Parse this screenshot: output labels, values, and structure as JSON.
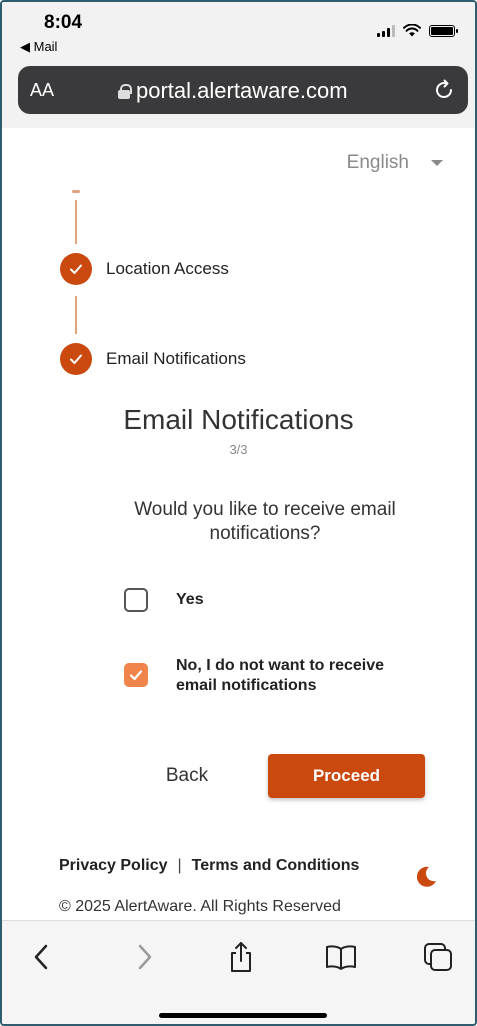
{
  "status_bar": {
    "time": "8:04",
    "back_app": "◀ Mail"
  },
  "browser": {
    "text_size_label": "AA",
    "url": "portal.alertaware.com"
  },
  "language": {
    "selected": "English"
  },
  "stepper": {
    "steps": [
      {
        "label": "Location Access",
        "completed": true
      },
      {
        "label": "Email Notifications",
        "completed": true
      }
    ]
  },
  "page": {
    "title": "Email Notifications",
    "step_count": "3/3",
    "question": "Would you like to receive email notifications?"
  },
  "options": [
    {
      "label": "Yes",
      "checked": false
    },
    {
      "label": "No, I do not want to receive email notifications",
      "checked": true
    }
  ],
  "actions": {
    "back_label": "Back",
    "proceed_label": "Proceed"
  },
  "footer": {
    "privacy_label": "Privacy Policy",
    "separator": "|",
    "terms_label": "Terms and Conditions",
    "copyright": "© 2025 AlertAware. All Rights Reserved"
  },
  "colors": {
    "accent": "#c9490e",
    "checkbox_checked": "#f0844a",
    "step_line": "#e0a57f"
  },
  "icons": {
    "check": "check-icon",
    "lock": "lock-icon",
    "reload": "reload-icon",
    "moon": "moon-icon",
    "back": "chevron-left-icon",
    "forward": "chevron-right-icon",
    "share": "share-icon",
    "bookmarks": "book-icon",
    "tabs": "tabs-icon"
  }
}
